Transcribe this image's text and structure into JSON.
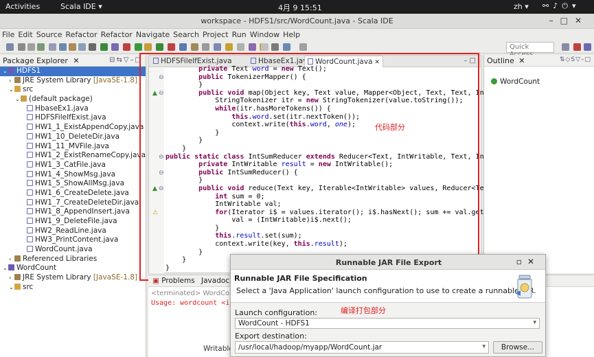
{
  "system": {
    "activities": "Activities",
    "app_menu": "Scala IDE ▾",
    "clock": "4月 9  15:51",
    "lang": "zh ▾",
    "tray_icons": "network-icon volume-icon power-icon"
  },
  "window": {
    "title": "workspace - HDFS1/src/WordCount.java - Scala IDE"
  },
  "menu": [
    "File",
    "Edit",
    "Source",
    "Refactor",
    "Refactor",
    "Navigate",
    "Search",
    "Project",
    "Run",
    "Window",
    "Help"
  ],
  "toolbar": {
    "quick_access_placeholder": "Quick Access"
  },
  "package_explorer": {
    "title": "Package Explorer",
    "tree": [
      {
        "indent": 0,
        "icon": "proj",
        "label": "HDFS1",
        "selected": true
      },
      {
        "indent": 1,
        "icon": "lib",
        "label": "JRE System Library",
        "ver": "[JavaSE-1.8]"
      },
      {
        "indent": 1,
        "icon": "src",
        "label": "src"
      },
      {
        "indent": 2,
        "icon": "pkg",
        "label": "(default package)"
      },
      {
        "indent": 3,
        "icon": "java",
        "label": "HbaseEx1.java"
      },
      {
        "indent": 3,
        "icon": "java",
        "label": "HDFSFileIfExist.java"
      },
      {
        "indent": 3,
        "icon": "java",
        "label": "HW1_1_ExistAppendCopy.java"
      },
      {
        "indent": 3,
        "icon": "java",
        "label": "HW1_10_DeleteDir.java"
      },
      {
        "indent": 3,
        "icon": "java",
        "label": "HW1_11_MVFile.java"
      },
      {
        "indent": 3,
        "icon": "java",
        "label": "HW1_2_ExistRenameCopy.java"
      },
      {
        "indent": 3,
        "icon": "java",
        "label": "HW1_3_CatFile.java"
      },
      {
        "indent": 3,
        "icon": "java",
        "label": "HW1_4_ShowMsg.java"
      },
      {
        "indent": 3,
        "icon": "java",
        "label": "HW1_5_ShowAllMsg.java"
      },
      {
        "indent": 3,
        "icon": "java",
        "label": "HW1_6_CreateDelete.java"
      },
      {
        "indent": 3,
        "icon": "java",
        "label": "HW1_7_CreateDeleteDir.java"
      },
      {
        "indent": 3,
        "icon": "java",
        "label": "HW1_8_AppendInsert.java"
      },
      {
        "indent": 3,
        "icon": "java",
        "label": "HW1_9_DeleteFile.java"
      },
      {
        "indent": 3,
        "icon": "java",
        "label": "HW2_ReadLine.java"
      },
      {
        "indent": 3,
        "icon": "java",
        "label": "HW3_PrintContent.java"
      },
      {
        "indent": 3,
        "icon": "java",
        "label": "WordCount.java"
      },
      {
        "indent": 1,
        "icon": "lib",
        "label": "Referenced Libraries"
      },
      {
        "indent": 0,
        "icon": "proj",
        "label": "WordCount"
      },
      {
        "indent": 1,
        "icon": "lib",
        "label": "JRE System Library",
        "ver": "[JavaSE-1.8]"
      },
      {
        "indent": 1,
        "icon": "src",
        "label": "src"
      }
    ]
  },
  "editor": {
    "tabs": [
      {
        "label": "HDFSFileIfExist.java",
        "active": false
      },
      {
        "label": "HbaseEx1.java",
        "active": false
      },
      {
        "label": "WordCount.java",
        "active": true
      }
    ],
    "close_glyph": "✕",
    "annotation": "代码部分",
    "code": [
      [
        [
          "p",
          "        "
        ],
        [
          "kw",
          "private"
        ],
        [
          "p",
          " Text "
        ],
        [
          "fld",
          "word"
        ],
        [
          "p",
          " = "
        ],
        [
          "kw",
          "new"
        ],
        [
          "p",
          " Text();"
        ]
      ],
      [
        [
          "p",
          "        "
        ],
        [
          "kw",
          "public"
        ],
        [
          "p",
          " TokenizerMapper() {"
        ]
      ],
      [
        [
          "p",
          "        }"
        ]
      ],
      [
        [
          "p",
          "        "
        ],
        [
          "kw",
          "public"
        ],
        [
          "p",
          " "
        ],
        [
          "kw",
          "void"
        ],
        [
          "p",
          " map(Object key, Text value, Mapper<Object, Text, Text, IntWrit"
        ]
      ],
      [
        [
          "p",
          "            StringTokenizer itr = "
        ],
        [
          "kw",
          "new"
        ],
        [
          "p",
          " StringTokenizer(value.toString());"
        ]
      ],
      [
        [
          "p",
          "            "
        ],
        [
          "kw",
          "while"
        ],
        [
          "p",
          "(itr.hasMoreTokens()) {"
        ]
      ],
      [
        [
          "p",
          "                "
        ],
        [
          "kw",
          "this"
        ],
        [
          "p",
          "."
        ],
        [
          "fld",
          "word"
        ],
        [
          "p",
          ".set(itr.nextToken());"
        ]
      ],
      [
        [
          "p",
          "                context.write("
        ],
        [
          "kw",
          "this"
        ],
        [
          "p",
          "."
        ],
        [
          "fld",
          "word"
        ],
        [
          "p",
          ", "
        ],
        [
          "fldit",
          "one"
        ],
        [
          "p",
          ");"
        ]
      ],
      [
        [
          "p",
          "            }"
        ]
      ],
      [
        [
          "p",
          "        }"
        ]
      ],
      [
        [
          "p",
          "    }"
        ]
      ],
      [
        [
          "kw",
          "public"
        ],
        [
          "p",
          " "
        ],
        [
          "kw",
          "static"
        ],
        [
          "p",
          " "
        ],
        [
          "kw",
          "class"
        ],
        [
          "p",
          " IntSumReducer "
        ],
        [
          "kw",
          "extends"
        ],
        [
          "p",
          " Reducer<Text, IntWritable, Text, IntWrit"
        ]
      ],
      [
        [
          "p",
          "        "
        ],
        [
          "kw",
          "private"
        ],
        [
          "p",
          " IntWritable "
        ],
        [
          "fld",
          "result"
        ],
        [
          "p",
          " = "
        ],
        [
          "kw",
          "new"
        ],
        [
          "p",
          " IntWritable();"
        ]
      ],
      [
        [
          "p",
          "        "
        ],
        [
          "kw",
          "public"
        ],
        [
          "p",
          " IntSumReducer() {"
        ]
      ],
      [
        [
          "p",
          "        }"
        ]
      ],
      [
        [
          "p",
          "        "
        ],
        [
          "kw",
          "public"
        ],
        [
          "p",
          " "
        ],
        [
          "kw",
          "void"
        ],
        [
          "p",
          " reduce(Text key, Iterable<IntWritable> values, Reducer<Text, I"
        ]
      ],
      [
        [
          "p",
          "            "
        ],
        [
          "kw",
          "int"
        ],
        [
          "p",
          " sum = 0;"
        ]
      ],
      [
        [
          "p",
          "            IntWritable val;"
        ]
      ],
      [
        [
          "p",
          "            "
        ],
        [
          "kw",
          "for"
        ],
        [
          "p",
          "(Iterator i$ = values.iterator(); i$.hasNext(); sum += val.get()) {"
        ]
      ],
      [
        [
          "p",
          "                val = (IntWritable)i$.next();"
        ]
      ],
      [
        [
          "p",
          "            }"
        ]
      ],
      [
        [
          "p",
          "            "
        ],
        [
          "kw",
          "this"
        ],
        [
          "p",
          "."
        ],
        [
          "fld",
          "result"
        ],
        [
          "p",
          ".set(sum);"
        ]
      ],
      [
        [
          "p",
          "            context.write(key, "
        ],
        [
          "kw",
          "this"
        ],
        [
          "p",
          "."
        ],
        [
          "fld",
          "result"
        ],
        [
          "p",
          ");"
        ]
      ],
      [
        [
          "p",
          "        }"
        ]
      ],
      [
        [
          "p",
          "    }"
        ]
      ],
      [
        [
          "p",
          "}"
        ]
      ]
    ]
  },
  "outline": {
    "title": "Outline",
    "item": "WordCount"
  },
  "bottom_panel": {
    "tab_problems": "Problems",
    "tab_javadoc": "Javadoc",
    "terminated": "<terminated> WordCount",
    "usage": "Usage: wordcount <in"
  },
  "statusbar": {
    "writable": "Writable"
  },
  "dialog": {
    "title": "Runnable JAR File Export",
    "heading": "Runnable JAR File Specification",
    "description": "Select a 'Java Application' launch configuration to use to create a runnable JAR.",
    "annotation": "编译打包部分",
    "launch_label": "Launch configuration:",
    "launch_value": "WordCount - HDFS1",
    "dest_label": "Export destination:",
    "dest_value": "/usr/local/hadoop/myapp/WordCount.jar",
    "browse_label": "Browse..."
  },
  "colors": {
    "accent_red": "#e02020",
    "selection": "#3d74c9",
    "keyword": "#7f0055",
    "field": "#0000c0"
  }
}
